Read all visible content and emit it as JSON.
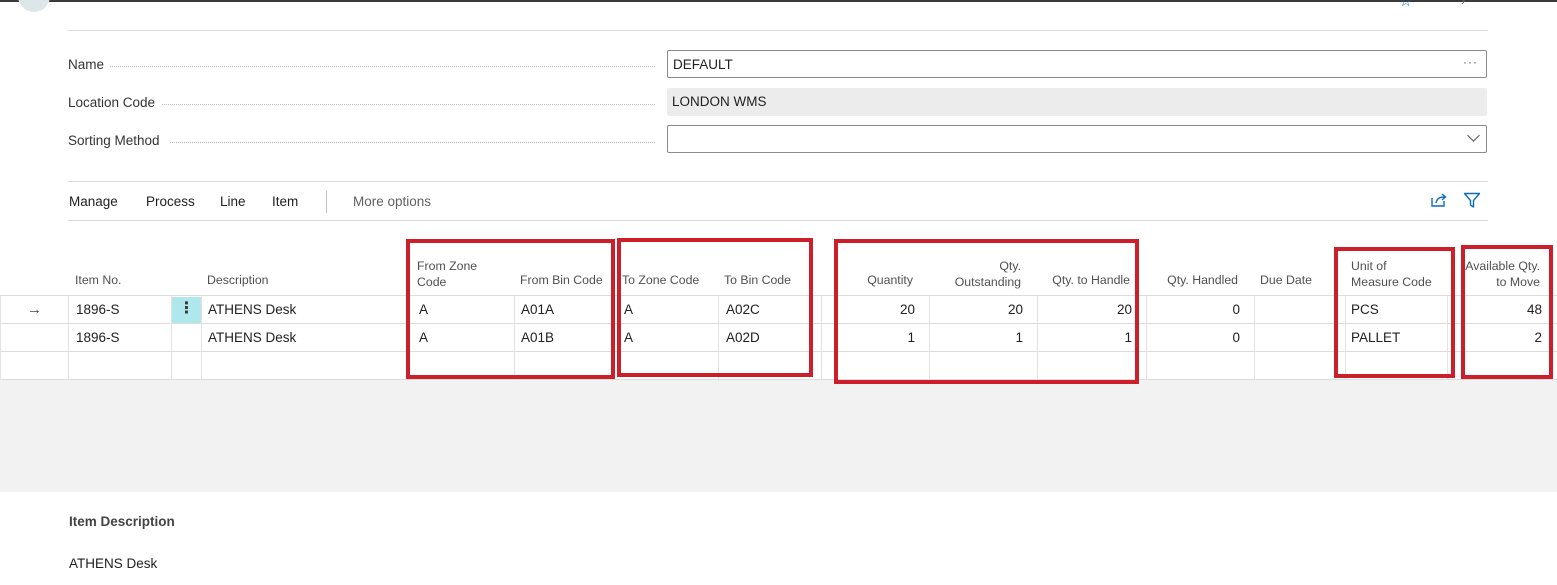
{
  "form": {
    "name": {
      "label": "Name",
      "value": "DEFAULT",
      "trail": "···"
    },
    "location_code": {
      "label": "Location Code",
      "value": "LONDON WMS"
    },
    "sorting_method": {
      "label": "Sorting Method",
      "value": ""
    }
  },
  "actions": {
    "manage": "Manage",
    "process": "Process",
    "line": "Line",
    "item": "Item",
    "more": "More options"
  },
  "icons": [
    "star-icon",
    "chevron-icon",
    "share-icon",
    "filter-icon",
    "arrow-right-icon",
    "more-vertical-icon",
    "chevron-down-icon"
  ],
  "columns": {
    "item_no": "Item No.",
    "description": "Description",
    "from_zone_code": [
      "From Zone",
      "Code"
    ],
    "from_bin_code": "From Bin Code",
    "to_zone_code": "To Zone Code",
    "to_bin_code": "To Bin Code",
    "quantity": "Quantity",
    "qty_outstanding": [
      "Qty.",
      "Outstanding"
    ],
    "qty_to_handle": "Qty. to Handle",
    "qty_handled": "Qty. Handled",
    "due_date": "Due Date",
    "unit_of_measure_code": [
      "Unit of",
      "Measure Code"
    ],
    "available_qty_to_move": [
      "Available Qty.",
      "to Move"
    ]
  },
  "rows": [
    {
      "item_no": "1896-S",
      "description": "ATHENS Desk",
      "from_zone": "A",
      "from_bin": "A01A",
      "to_zone": "A",
      "to_bin": "A02C",
      "quantity": "20",
      "outstanding": "20",
      "to_handle": "20",
      "handled": "0",
      "due_date": "",
      "uom": "PCS",
      "available": "48"
    },
    {
      "item_no": "1896-S",
      "description": "ATHENS Desk",
      "from_zone": "A",
      "from_bin": "A01B",
      "to_zone": "A",
      "to_bin": "A02D",
      "quantity": "1",
      "outstanding": "1",
      "to_handle": "1",
      "handled": "0",
      "due_date": "",
      "uom": "PALLET",
      "available": "2"
    }
  ],
  "factbox": {
    "label": "Item Description",
    "value": "ATHENS Desk"
  },
  "colors": {
    "highlight_border": "#cc1f2a",
    "row_menu_bg": "#aee8ec",
    "accent": "#0f6cbd"
  }
}
